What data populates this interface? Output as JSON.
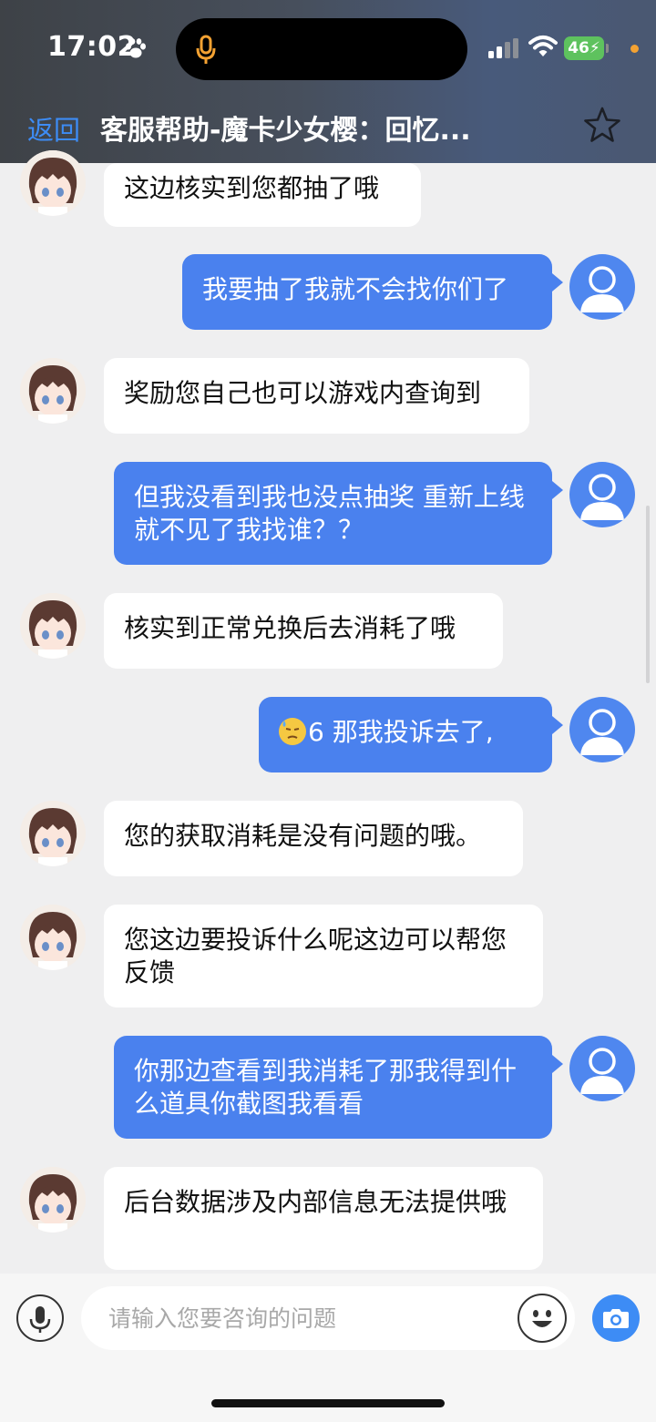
{
  "status_bar": {
    "time": "17:02",
    "battery": "46"
  },
  "nav": {
    "back_label": "返回",
    "title": "客服帮助-魔卡少女樱：回忆..."
  },
  "messages": [
    {
      "sender": "agent",
      "text": "这边核实到您都抽了哦"
    },
    {
      "sender": "user",
      "text": "我要抽了我就不会找你们了"
    },
    {
      "sender": "agent",
      "text": "奖励您自己也可以游戏内查询到"
    },
    {
      "sender": "user",
      "text": "但我没看到我也没点抽奖 重新上线就不见了我找谁？？"
    },
    {
      "sender": "agent",
      "text": "核实到正常兑换后去消耗了哦"
    },
    {
      "sender": "user",
      "text": "6 那我投诉去了,"
    },
    {
      "sender": "agent",
      "text": "您的获取消耗是没有问题的哦。"
    },
    {
      "sender": "agent",
      "text": "您这边要投诉什么呢这边可以帮您反馈"
    },
    {
      "sender": "user",
      "text": "你那边查看到我消耗了那我得到什么道具你截图我看看"
    },
    {
      "sender": "agent",
      "text": "后台数据涉及内部信息无法提供哦"
    }
  ],
  "input": {
    "placeholder": "请输入您要咨询的问题",
    "value": ""
  },
  "colors": {
    "accent": "#3d8cf5",
    "user_bubble": "#4a81ee",
    "agent_bubble": "#ffffff",
    "background": "#efeff0"
  }
}
